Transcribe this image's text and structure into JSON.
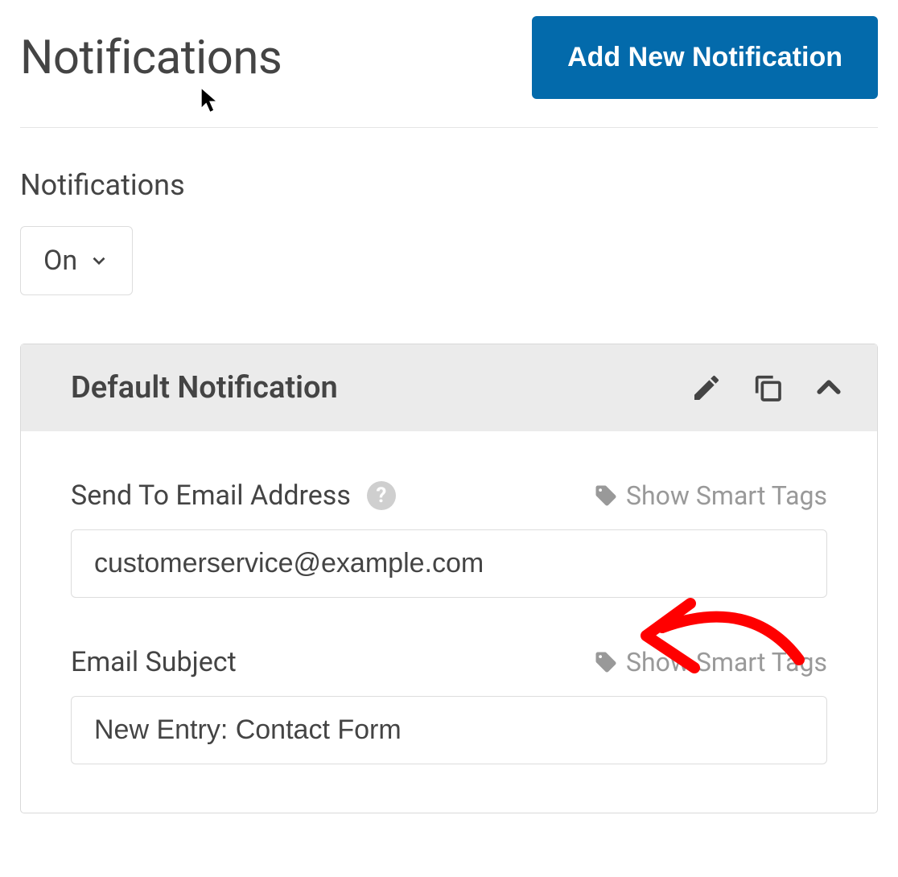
{
  "header": {
    "title": "Notifications",
    "add_button": "Add New Notification"
  },
  "notifications_section": {
    "label": "Notifications",
    "toggle_value": "On"
  },
  "panel": {
    "title": "Default Notification",
    "fields": {
      "send_to": {
        "label": "Send To Email Address",
        "smart_tags": "Show Smart Tags",
        "value": "customerservice@example.com"
      },
      "subject": {
        "label": "Email Subject",
        "smart_tags": "Show Smart Tags",
        "value": "New Entry: Contact Form"
      }
    }
  }
}
